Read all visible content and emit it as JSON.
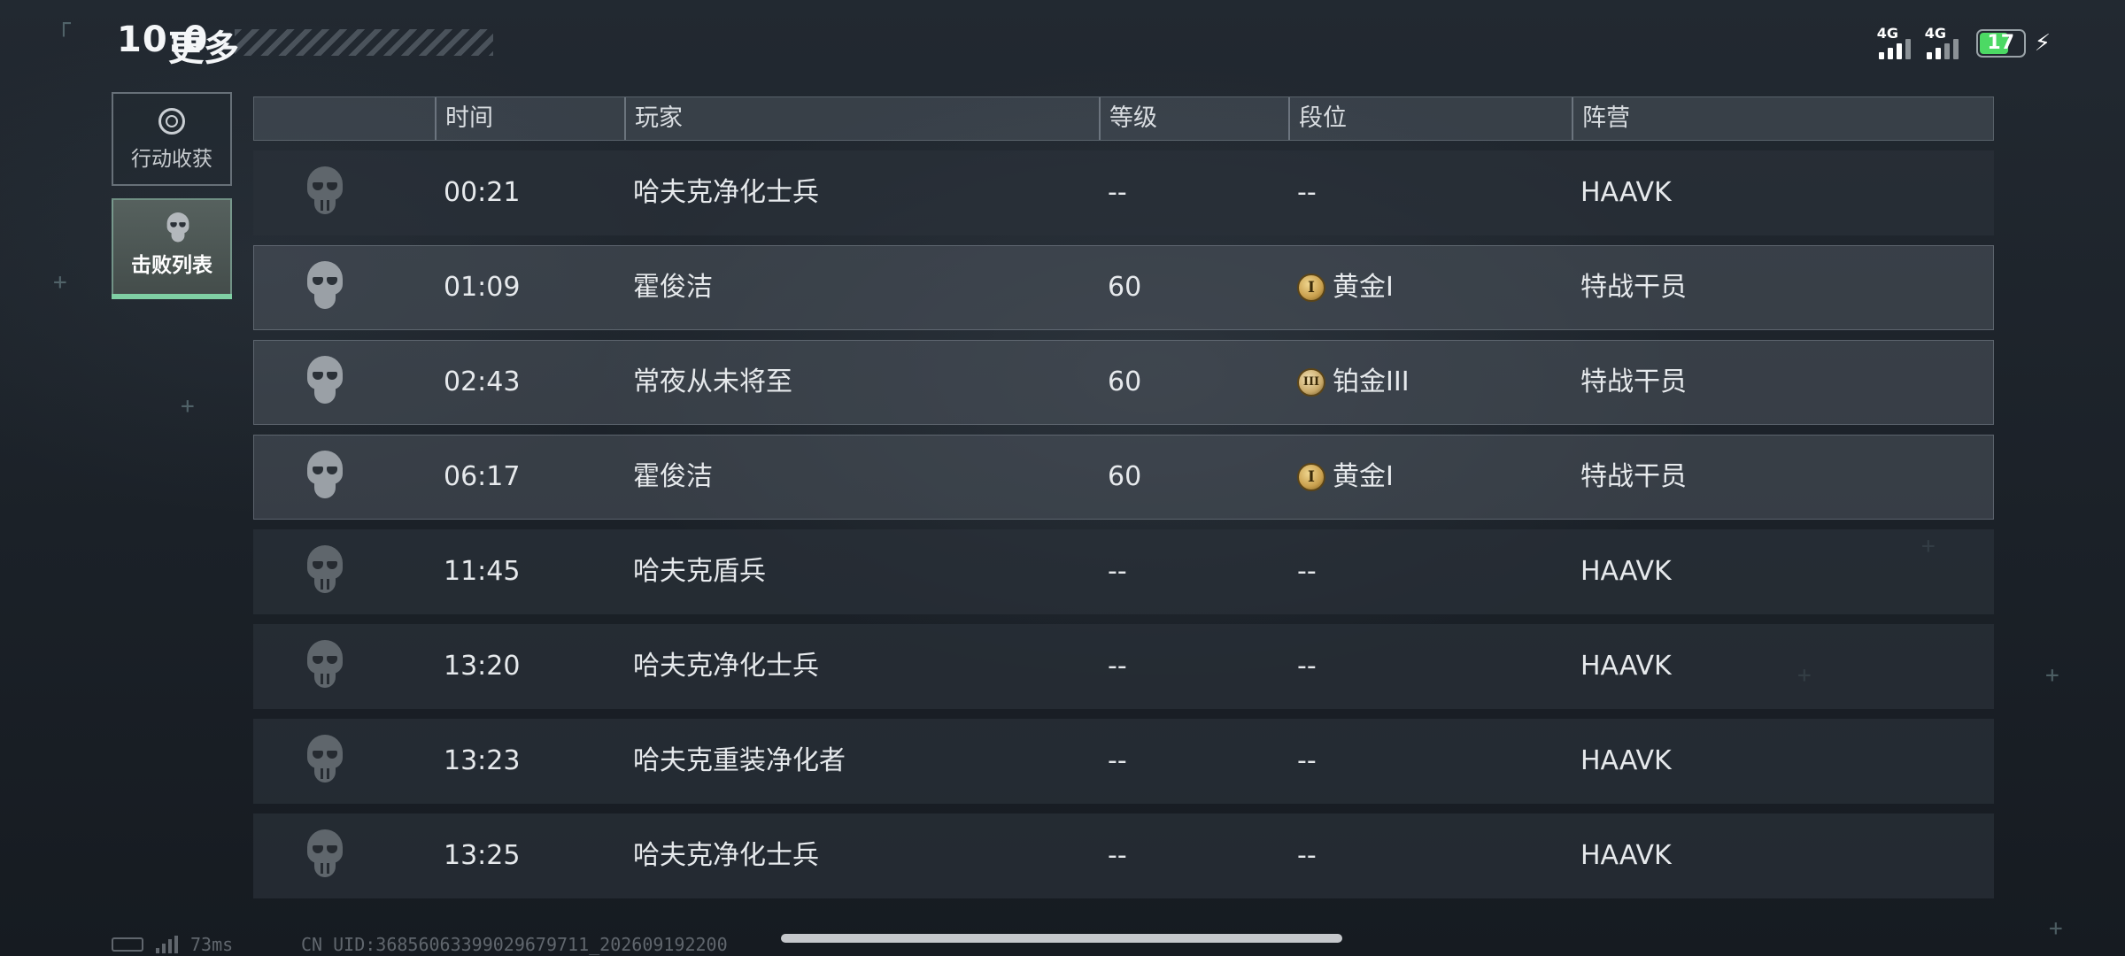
{
  "status_bar": {
    "time": "10:0",
    "network_1": "4G",
    "network_2": "4G",
    "battery_level": "17",
    "charging_icon": "bolt-icon"
  },
  "header": {
    "title": "更多"
  },
  "sidebar": {
    "items": [
      {
        "label": "行动收获",
        "icon": "loot-icon",
        "active": false
      },
      {
        "label": "击败列表",
        "icon": "skull-icon",
        "active": true
      }
    ]
  },
  "table": {
    "columns": [
      "时间",
      "玩家",
      "等级",
      "段位",
      "阵营"
    ],
    "rows": [
      {
        "type": "npc",
        "time": "00:21",
        "player": "哈夫克净化士兵",
        "level": "--",
        "rank": "--",
        "rank_icon": "",
        "faction": "HAAVK"
      },
      {
        "type": "player",
        "time": "01:09",
        "player": "霍俊洁",
        "level": "60",
        "rank": "黄金I",
        "rank_icon": "I",
        "faction": "特战干员"
      },
      {
        "type": "player",
        "time": "02:43",
        "player": "常夜从未将至",
        "level": "60",
        "rank": "铂金III",
        "rank_icon": "III",
        "faction": "特战干员"
      },
      {
        "type": "player",
        "time": "06:17",
        "player": "霍俊洁",
        "level": "60",
        "rank": "黄金I",
        "rank_icon": "I",
        "faction": "特战干员"
      },
      {
        "type": "npc",
        "time": "11:45",
        "player": "哈夫克盾兵",
        "level": "--",
        "rank": "--",
        "rank_icon": "",
        "faction": "HAAVK"
      },
      {
        "type": "npc",
        "time": "13:20",
        "player": "哈夫克净化士兵",
        "level": "--",
        "rank": "--",
        "rank_icon": "",
        "faction": "HAAVK"
      },
      {
        "type": "npc",
        "time": "13:23",
        "player": "哈夫克重装净化者",
        "level": "--",
        "rank": "--",
        "rank_icon": "",
        "faction": "HAAVK"
      },
      {
        "type": "npc",
        "time": "13:25",
        "player": "哈夫克净化士兵",
        "level": "--",
        "rank": "--",
        "rank_icon": "",
        "faction": "HAAVK"
      }
    ]
  },
  "footer": {
    "latency": "73ms",
    "uid": "CN UID:3685606339902967971​1_202609192200"
  },
  "colors": {
    "accent": "#7fd0a4",
    "battery": "#4cd964",
    "rank_gold": "#c9a04e"
  }
}
